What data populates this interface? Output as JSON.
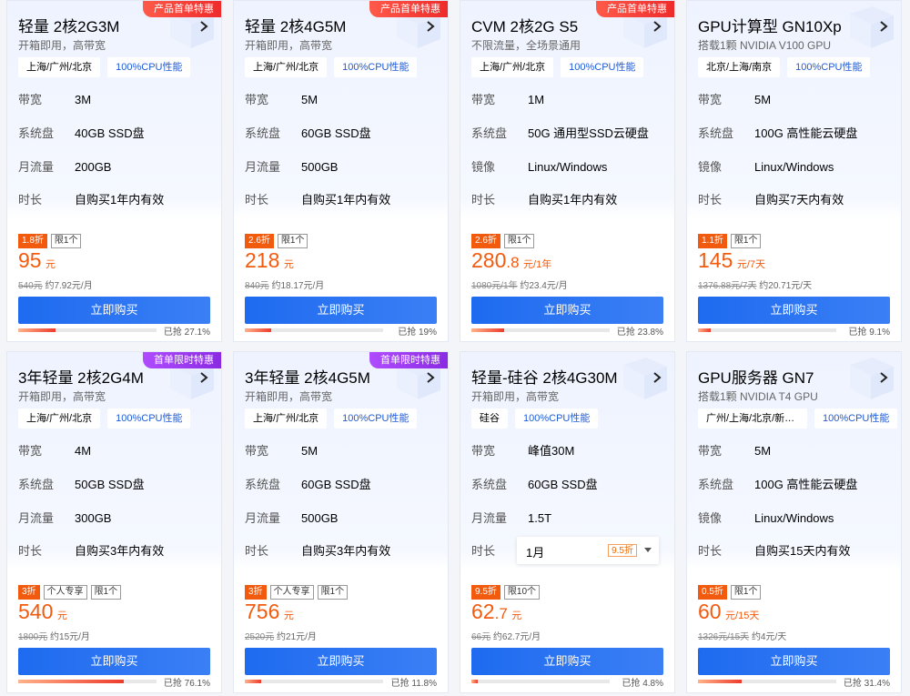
{
  "cards": [
    {
      "badge": "产品首单特惠",
      "badge_color": "red",
      "title": "轻量 2核2G3M",
      "subtitle": "开箱即用，高带宽",
      "tags": [
        "上海/广州/北京",
        "100%CPU性能"
      ],
      "specs": [
        {
          "k": "带宽",
          "v": "3M"
        },
        {
          "k": "系统盘",
          "v": "40GB SSD盘"
        },
        {
          "k": "月流量",
          "v": "200GB"
        },
        {
          "k": "时长",
          "v": "自购买1年内有效"
        }
      ],
      "pills": [
        "1.8折",
        "限1个"
      ],
      "price_main": "95",
      "price_unit": "元",
      "orig_price": "540元",
      "avg_price": "约7.92元/月",
      "button": "立即购买",
      "sold": "已抢 27.1%",
      "progress": 0.271
    },
    {
      "badge": "产品首单特惠",
      "badge_color": "red",
      "title": "轻量 2核4G5M",
      "subtitle": "开箱即用，高带宽",
      "tags": [
        "上海/广州/北京",
        "100%CPU性能"
      ],
      "specs": [
        {
          "k": "带宽",
          "v": "5M"
        },
        {
          "k": "系统盘",
          "v": "60GB SSD盘"
        },
        {
          "k": "月流量",
          "v": "500GB"
        },
        {
          "k": "时长",
          "v": "自购买1年内有效"
        }
      ],
      "pills": [
        "2.6折",
        "限1个"
      ],
      "price_main": "218",
      "price_unit": "元",
      "orig_price": "840元",
      "avg_price": "约18.17元/月",
      "button": "立即购买",
      "sold": "已抢 19%",
      "progress": 0.19
    },
    {
      "badge": "产品首单特惠",
      "badge_color": "red",
      "title": "CVM 2核2G S5",
      "subtitle": "不限流量，全场景通用",
      "tags": [
        "上海/广州/北京",
        "100%CPU性能"
      ],
      "specs": [
        {
          "k": "带宽",
          "v": "1M"
        },
        {
          "k": "系统盘",
          "v": "50G 通用型SSD云硬盘"
        },
        {
          "k": "镜像",
          "v": "Linux/Windows"
        },
        {
          "k": "时长",
          "v": "自购买1年内有效"
        }
      ],
      "pills": [
        "2.6折",
        "限1个"
      ],
      "price_main": "280",
      "price_decimal": ".8",
      "price_unit": "元/1年",
      "orig_price": "1080元/1年",
      "avg_price": "约23.4元/月",
      "button": "立即购买",
      "sold": "已抢 23.8%",
      "progress": 0.238
    },
    {
      "badge": "",
      "badge_color": "",
      "title": "GPU计算型 GN10Xp",
      "subtitle": "搭载1颗 NVIDIA V100 GPU",
      "tags": [
        "北京/上海/南京",
        "100%CPU性能"
      ],
      "specs": [
        {
          "k": "带宽",
          "v": "5M"
        },
        {
          "k": "系统盘",
          "v": "100G 高性能云硬盘"
        },
        {
          "k": "镜像",
          "v": "Linux/Windows"
        },
        {
          "k": "时长",
          "v": "自购买7天内有效"
        }
      ],
      "pills": [
        "1.1折",
        "限1个"
      ],
      "price_main": "145",
      "price_unit": "元/7天",
      "orig_price": "1376.88元/7天",
      "avg_price": "约20.71元/天",
      "button": "立即购买",
      "sold": "已抢 9.1%",
      "progress": 0.091
    },
    {
      "badge": "首单限时特惠",
      "badge_color": "purple",
      "title": "3年轻量 2核2G4M",
      "subtitle": "开箱即用，高带宽",
      "tags": [
        "上海/广州/北京",
        "100%CPU性能"
      ],
      "specs": [
        {
          "k": "带宽",
          "v": "4M"
        },
        {
          "k": "系统盘",
          "v": "50GB SSD盘"
        },
        {
          "k": "月流量",
          "v": "300GB"
        },
        {
          "k": "时长",
          "v": "自购买3年内有效"
        }
      ],
      "pills": [
        "3折",
        "个人专享",
        "限1个"
      ],
      "price_main": "540",
      "price_unit": "元",
      "orig_price": "1800元",
      "avg_price": "约15元/月",
      "button": "立即购买",
      "sold": "已抢 76.1%",
      "progress": 0.761
    },
    {
      "badge": "首单限时特惠",
      "badge_color": "purple",
      "title": "3年轻量 2核4G5M",
      "subtitle": "开箱即用，高带宽",
      "tags": [
        "上海/广州/北京",
        "100%CPU性能"
      ],
      "specs": [
        {
          "k": "带宽",
          "v": "5M"
        },
        {
          "k": "系统盘",
          "v": "60GB SSD盘"
        },
        {
          "k": "月流量",
          "v": "500GB"
        },
        {
          "k": "时长",
          "v": "自购买3年内有效"
        }
      ],
      "pills": [
        "3折",
        "个人专享",
        "限1个"
      ],
      "price_main": "756",
      "price_unit": "元",
      "orig_price": "2520元",
      "avg_price": "约21元/月",
      "button": "立即购买",
      "sold": "已抢 11.8%",
      "progress": 0.118
    },
    {
      "badge": "",
      "badge_color": "",
      "title": "轻量-硅谷 2核4G30M",
      "subtitle": "开箱即用，高带宽",
      "tags": [
        "硅谷",
        "100%CPU性能"
      ],
      "specs": [
        {
          "k": "带宽",
          "v": "峰值30M"
        },
        {
          "k": "系统盘",
          "v": "60GB SSD盘"
        },
        {
          "k": "月流量",
          "v": "1.5T"
        },
        {
          "k": "时长",
          "v": ""
        }
      ],
      "select": {
        "value": "1月",
        "discount": "9.5折"
      },
      "pills": [
        "9.5折",
        "限10个"
      ],
      "price_main": "62",
      "price_decimal": ".7",
      "price_unit": "元",
      "orig_price": "66元",
      "avg_price": "约62.7元/月",
      "button": "立即购买",
      "sold": "已抢 4.8%",
      "progress": 0.048
    },
    {
      "badge": "",
      "badge_color": "",
      "title": "GPU服务器 GN7",
      "subtitle": "搭载1颗 NVIDIA T4 GPU",
      "tags": [
        "广州/上海/北京/新加坡",
        "100%CPU性能"
      ],
      "specs": [
        {
          "k": "带宽",
          "v": "5M"
        },
        {
          "k": "系统盘",
          "v": "100G 高性能云硬盘"
        },
        {
          "k": "镜像",
          "v": "Linux/Windows"
        },
        {
          "k": "时长",
          "v": "自购买15天内有效"
        }
      ],
      "pills": [
        "0.5折",
        "限1个"
      ],
      "price_main": "60",
      "price_unit": "元/15天",
      "orig_price": "1326元/15天",
      "avg_price": "约4元/天",
      "button": "立即购买",
      "sold": "已抢 31.4%",
      "progress": 0.314
    }
  ]
}
